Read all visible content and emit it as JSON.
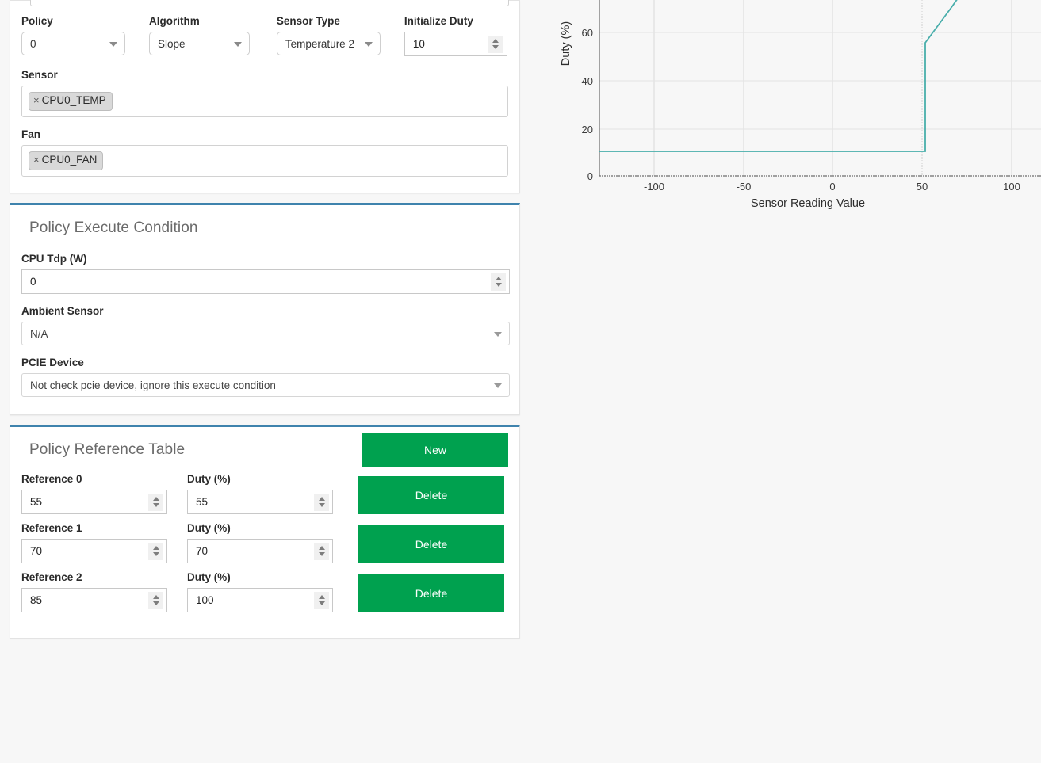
{
  "policy_form": {
    "fields": [
      {
        "label": "Policy",
        "value": "0",
        "control": "select",
        "name": "policy"
      },
      {
        "label": "Algorithm",
        "value": "Slope",
        "control": "select",
        "name": "algorithm"
      },
      {
        "label": "Sensor Type",
        "value": "Temperature 2",
        "control": "select",
        "name": "sensor-type"
      },
      {
        "label": "Initialize Duty",
        "value": "10",
        "control": "spinner",
        "name": "initialize-duty"
      }
    ],
    "sensor": {
      "label": "Sensor",
      "chips": [
        "CPU0_TEMP"
      ]
    },
    "fan": {
      "label": "Fan",
      "chips": [
        "CPU0_FAN"
      ]
    },
    "chip_remove_glyph": "×"
  },
  "execute_condition": {
    "title": "Policy Execute Condition",
    "cpu_tdp": {
      "label": "CPU Tdp (W)",
      "value": "0"
    },
    "ambient_sensor": {
      "label": "Ambient Sensor",
      "value": "N/A"
    },
    "pcie_device": {
      "label": "PCIE Device",
      "value": "Not check pcie device, ignore this execute condition"
    }
  },
  "reference_table": {
    "title": "Policy Reference Table",
    "new_label": "New",
    "delete_label": "Delete",
    "duty_label": "Duty (%)",
    "rows": [
      {
        "ref_label": "Reference 0",
        "ref_value": "55",
        "duty_value": "55"
      },
      {
        "ref_label": "Reference 1",
        "ref_value": "70",
        "duty_value": "70"
      },
      {
        "ref_label": "Reference 2",
        "ref_value": "85",
        "duty_value": "100"
      }
    ]
  },
  "colors": {
    "accent_blue": "#3f83ad",
    "green": "#00a14f",
    "chart_line": "#49aeab",
    "page_bg": "#f7f7f7"
  },
  "chart_data": {
    "type": "line",
    "title": "",
    "xlabel": "Sensor Reading Value",
    "ylabel": "Duty (%)",
    "xlim": [
      -128,
      127
    ],
    "ylim": [
      0,
      72
    ],
    "xticks": [
      -100,
      -50,
      0,
      50,
      100
    ],
    "yticks": [
      0,
      20,
      40,
      60
    ],
    "grid": true,
    "legend": "none",
    "series": [
      {
        "name": "duty-curve",
        "color": "#49aeab",
        "x": [
          -128,
          55,
          55,
          70,
          73
        ],
        "y": [
          10,
          10,
          55,
          70,
          72
        ]
      }
    ],
    "annotations": "Step from initialize duty 10% up to 55% at sensor reading 55, then linear slope to 70% at 70, continuing beyond top of visible plot."
  }
}
